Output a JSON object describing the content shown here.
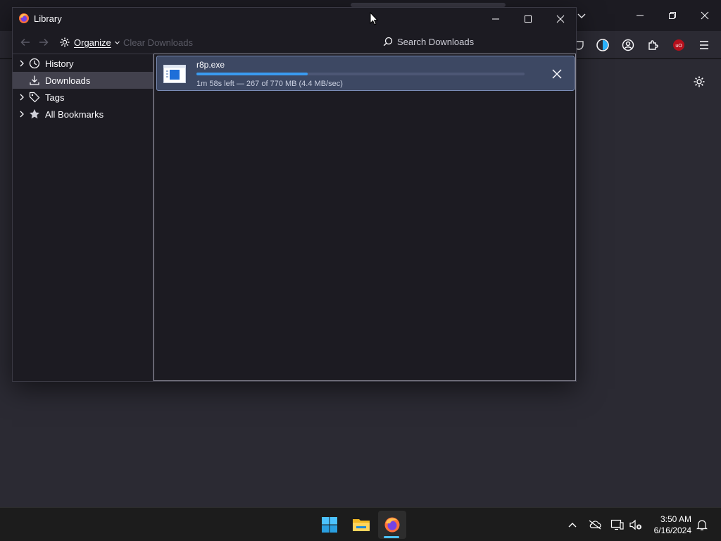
{
  "library": {
    "title": "Library",
    "organize_label": "Organize",
    "clear_downloads_label": "Clear Downloads",
    "search_placeholder": "Search Downloads"
  },
  "sidebar": {
    "items": [
      {
        "label": "History",
        "icon": "clock-icon",
        "expandable": true,
        "selected": false
      },
      {
        "label": "Downloads",
        "icon": "download-icon",
        "expandable": false,
        "selected": true
      },
      {
        "label": "Tags",
        "icon": "tag-icon",
        "expandable": true,
        "selected": false
      },
      {
        "label": "All Bookmarks",
        "icon": "star-icon",
        "expandable": true,
        "selected": false
      }
    ]
  },
  "downloads": [
    {
      "filename": "r8p.exe",
      "status": "1m 58s left — 267 of 770 MB (4.4 MB/sec)",
      "progress": 0.34
    }
  ],
  "taskbar": {
    "time": "3:50 AM",
    "date": "6/16/2024"
  },
  "colors": {
    "accent": "#3a9bf0",
    "selected_download_bg": "#3d4863",
    "ublock_red": "#b5101c",
    "taskbar_indicator": "#4cc2ff"
  }
}
